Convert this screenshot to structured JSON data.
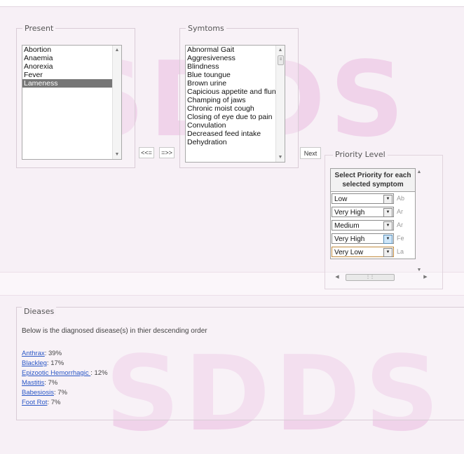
{
  "watermark": "SDDS",
  "present": {
    "legend": "Present",
    "items": [
      "Abortion",
      "Anaemia",
      "Anorexia",
      "Fever",
      "Lameness"
    ],
    "selected": "Lameness"
  },
  "buttons": {
    "remove": "<<=",
    "add": "=>>",
    "next": "Next"
  },
  "symptoms": {
    "legend": "Symtoms",
    "items": [
      "Abnormal Gait",
      "Aggresiveness",
      "Blindness",
      "Blue toungue",
      "Brown urine",
      "Capicious appetite and fluntuat",
      "Champing of jaws",
      "Chronic moist cough",
      "Closing of eye due to pain",
      "Convulation",
      "Decreased feed intake",
      "Dehydration"
    ]
  },
  "priority": {
    "legend": "Priority Level",
    "header": "Select Priority for each selected symptom",
    "rows": [
      {
        "value": "Low",
        "abbr": "Ab"
      },
      {
        "value": "Very High",
        "abbr": "Ar"
      },
      {
        "value": "Medium",
        "abbr": "Ar"
      },
      {
        "value": "Very High",
        "abbr": "Fe"
      },
      {
        "value": "Very Low",
        "abbr": "La"
      }
    ]
  },
  "diseases": {
    "legend": "Dieases",
    "intro": "Below is the diagnosed disease(s) in thier descending order",
    "items": [
      {
        "name": "Anthrax",
        "pct": ": 39%"
      },
      {
        "name": "Blackleg",
        "pct": ": 17%"
      },
      {
        "name": "Epizootic Hemorrhagic ",
        "pct": ": 12%"
      },
      {
        "name": "Mastitis",
        "pct": ": 7%"
      },
      {
        "name": "Babesiosis",
        "pct": ": 7%"
      },
      {
        "name": "Foot Rot",
        "pct": ": 7%"
      }
    ]
  }
}
